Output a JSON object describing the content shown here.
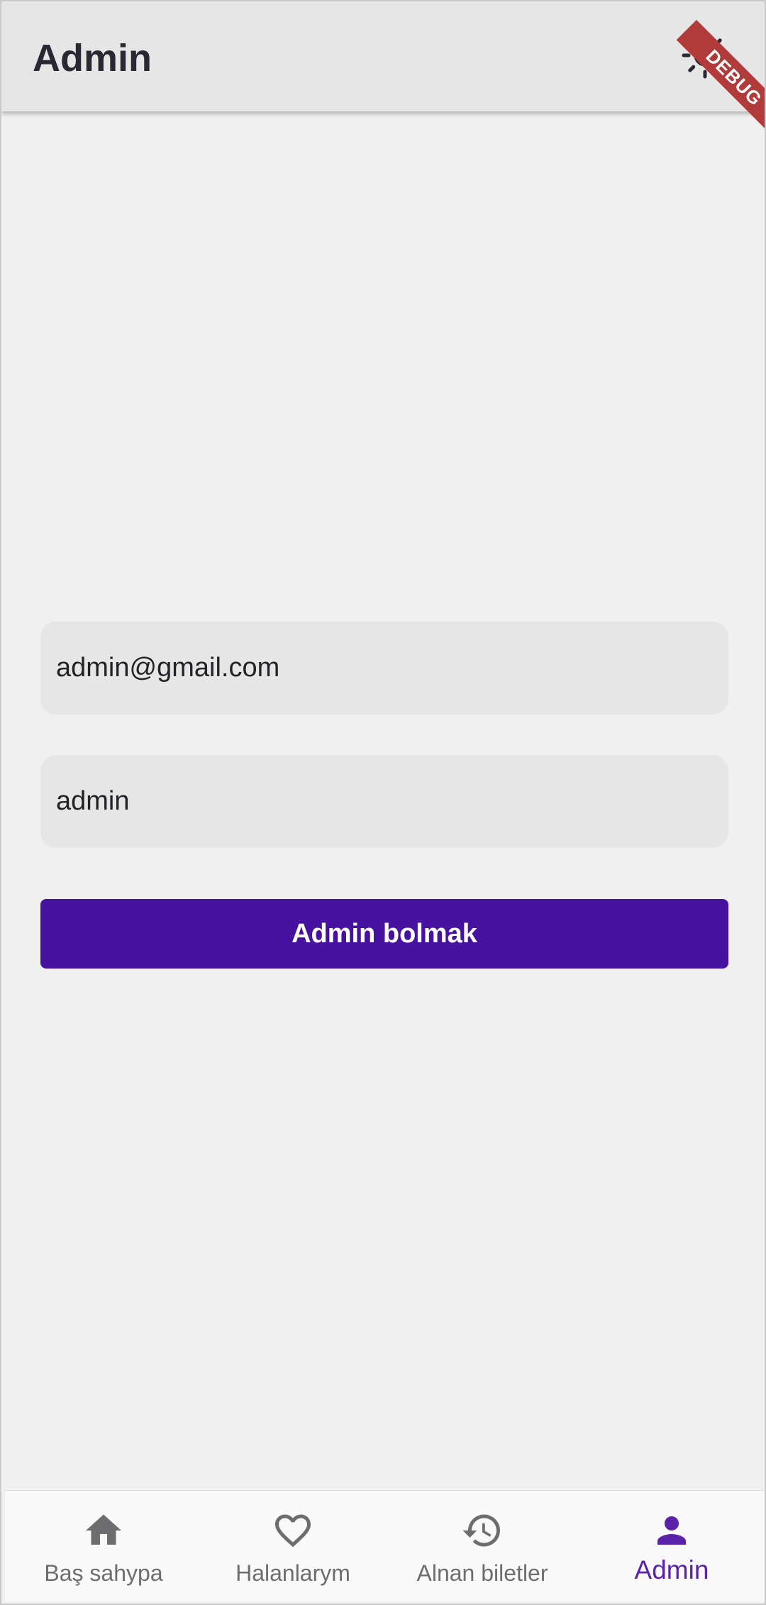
{
  "app_bar": {
    "title": "Admin",
    "theme_toggle_icon": "sun-icon"
  },
  "debug_banner": {
    "text": "DEBUG",
    "color": "#b13a3a"
  },
  "form": {
    "email": {
      "value": "admin@gmail.com"
    },
    "password": {
      "value": "admin"
    },
    "submit_label": "Admin bolmak"
  },
  "bottom_nav": {
    "items": [
      {
        "label": "Baş sahypa",
        "icon": "home-icon",
        "active": false
      },
      {
        "label": "Halanlarym",
        "icon": "heart-outline-icon",
        "active": false
      },
      {
        "label": "Alnan biletler",
        "icon": "history-icon",
        "active": false
      },
      {
        "label": "Admin",
        "icon": "person-icon",
        "active": true
      }
    ]
  },
  "colors": {
    "accent": "#4712a0",
    "active_nav": "#5a22a8",
    "background": "#f0f0f1",
    "app_bar": "#e6e6e7",
    "field_background": "#e6e6e7"
  }
}
